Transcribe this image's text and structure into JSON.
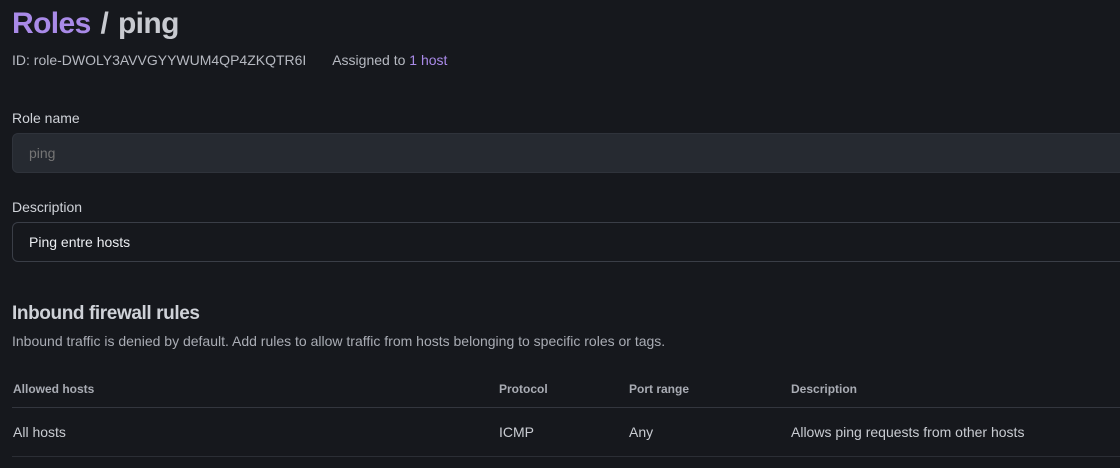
{
  "breadcrumb": {
    "parent": "Roles",
    "separator": "/",
    "current": "ping"
  },
  "meta": {
    "id_text": "ID: role-DWOLY3AVVGYYWUM4QP4ZKQTR6I",
    "assigned_prefix": "Assigned to",
    "assigned_link": "1 host"
  },
  "form": {
    "role_name": {
      "label": "Role name",
      "placeholder": "ping",
      "value": ""
    },
    "description": {
      "label": "Description",
      "value": "Ping entre hosts"
    }
  },
  "firewall": {
    "title": "Inbound firewall rules",
    "subtitle": "Inbound traffic is denied by default. Add rules to allow traffic from hosts belonging to specific roles or tags.",
    "columns": [
      "Allowed hosts",
      "Protocol",
      "Port range",
      "Description"
    ],
    "rows": [
      {
        "allowed_hosts": "All hosts",
        "protocol": "ICMP",
        "port_range": "Any",
        "description": "Allows ping requests from other hosts"
      }
    ]
  },
  "colors": {
    "accent": "#a98ae8",
    "background": "#16181d"
  }
}
